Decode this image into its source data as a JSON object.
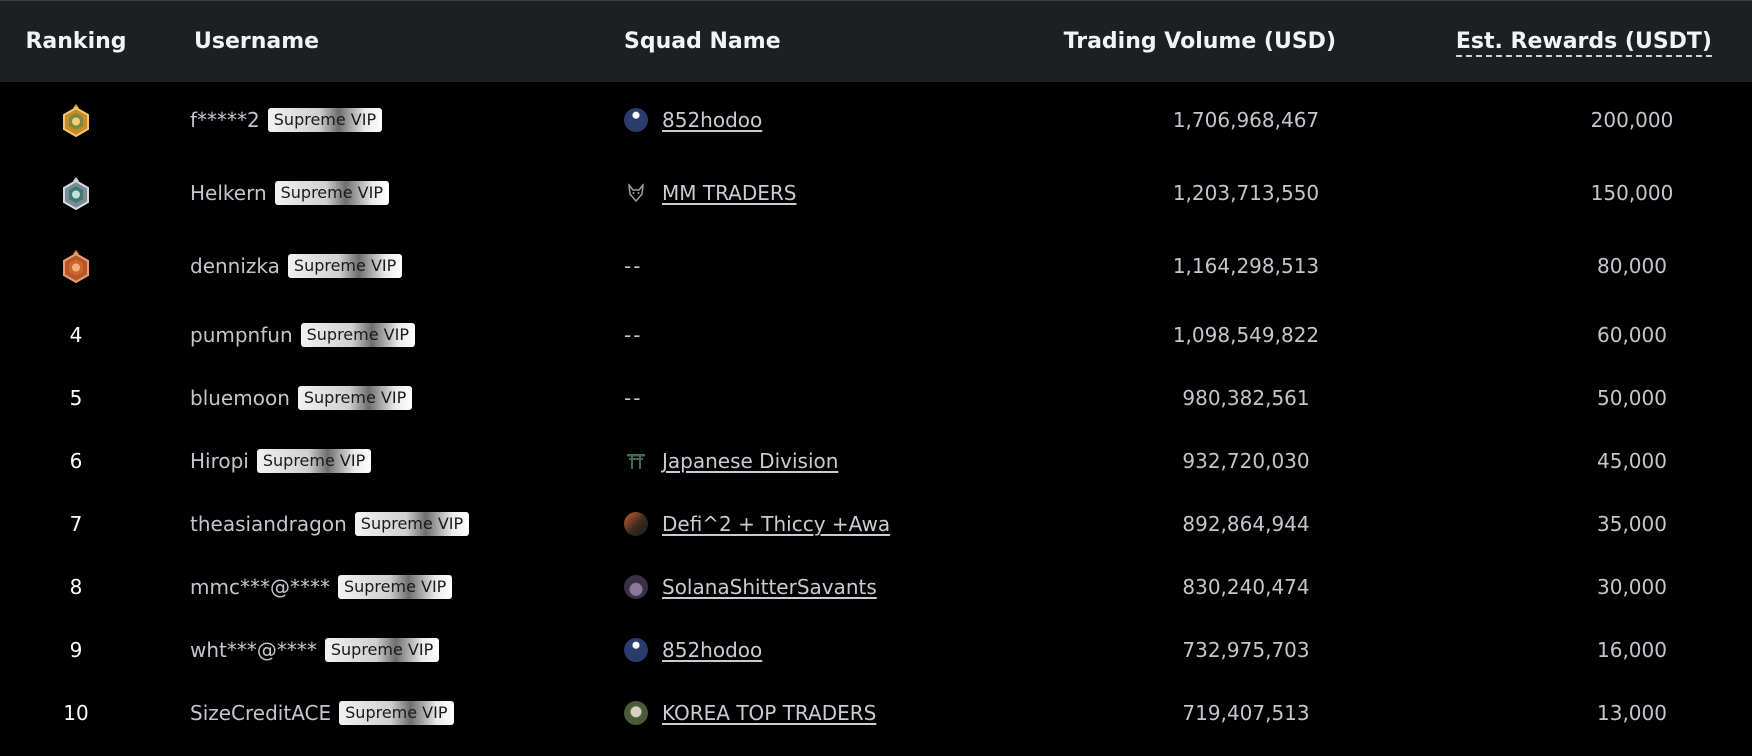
{
  "headers": {
    "ranking": "Ranking",
    "username": "Username",
    "squad": "Squad Name",
    "volume": "Trading Volume (USD)",
    "rewards": "Est. Rewards (USDT)"
  },
  "rows": [
    {
      "rank": "",
      "medal": "gold-medal-icon",
      "user": "f*****2",
      "badge": "Supreme VIP",
      "squad": "852hodoo",
      "squad_icon": "rocket-avatar-icon",
      "volume": "1,706,968,467",
      "reward": "200,000"
    },
    {
      "rank": "",
      "medal": "silver-medal-icon",
      "user": "Helkern",
      "badge": "Supreme VIP",
      "squad": "MM TRADERS",
      "squad_icon": "wolf-icon",
      "volume": "1,203,713,550",
      "reward": "150,000"
    },
    {
      "rank": "",
      "medal": "bronze-medal-icon",
      "user": "dennizka",
      "badge": "Supreme VIP",
      "squad": "--",
      "squad_icon": "",
      "volume": "1,164,298,513",
      "reward": "80,000"
    },
    {
      "rank": "4",
      "user": "pumpnfun",
      "badge": "Supreme VIP",
      "squad": "--",
      "squad_icon": "",
      "volume": "1,098,549,822",
      "reward": "60,000"
    },
    {
      "rank": "5",
      "user": "bluemoon",
      "badge": "Supreme VIP",
      "squad": "--",
      "squad_icon": "",
      "volume": "980,382,561",
      "reward": "50,000"
    },
    {
      "rank": "6",
      "user": "Hiropi",
      "badge": "Supreme VIP",
      "squad": "Japanese Division",
      "squad_icon": "torii-gate-icon",
      "volume": "932,720,030",
      "reward": "45,000"
    },
    {
      "rank": "7",
      "user": "theasiandragon",
      "badge": "Supreme VIP",
      "squad": "Defi^2 + Thiccy +Awa",
      "squad_icon": "planet-avatar-icon",
      "volume": "892,864,944",
      "reward": "35,000"
    },
    {
      "rank": "8",
      "user": "mmc***@****",
      "badge": "Supreme VIP",
      "squad": "SolanaShitterSavants",
      "squad_icon": "monster-avatar-icon",
      "volume": "830,240,474",
      "reward": "30,000"
    },
    {
      "rank": "9",
      "user": "wht***@****",
      "badge": "Supreme VIP",
      "squad": "852hodoo",
      "squad_icon": "rocket-avatar-icon",
      "volume": "732,975,703",
      "reward": "16,000"
    },
    {
      "rank": "10",
      "user": "SizeCreditACE",
      "badge": "Supreme VIP",
      "squad": "KOREA TOP TRADERS",
      "squad_icon": "skull-avatar-icon",
      "volume": "719,407,513",
      "reward": "13,000"
    }
  ]
}
